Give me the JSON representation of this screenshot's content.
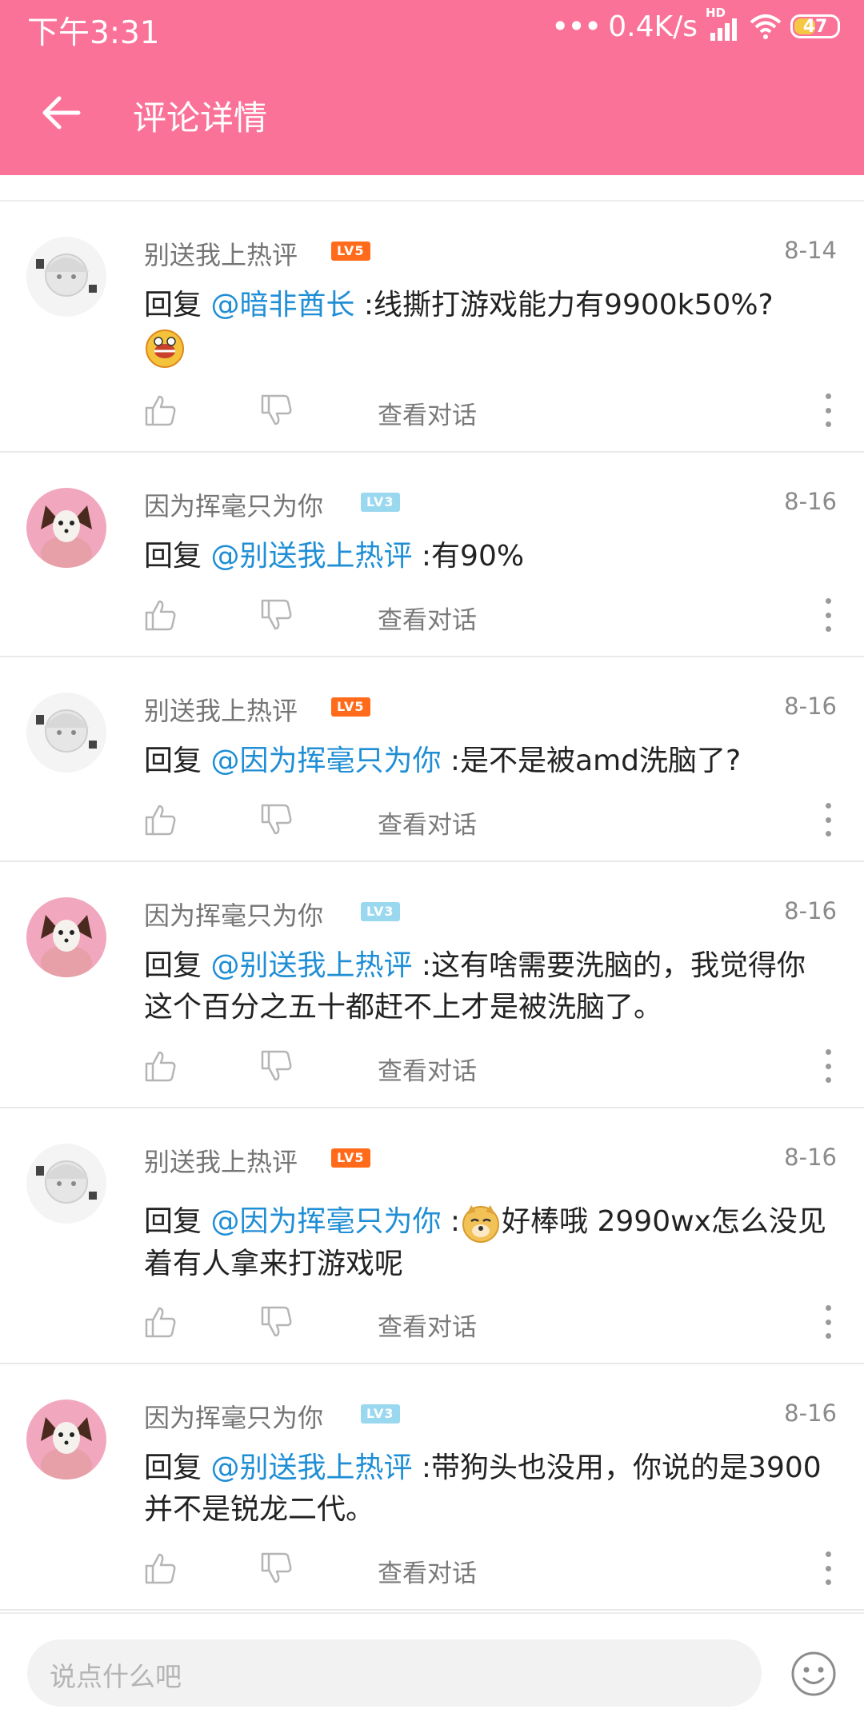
{
  "status_bar": {
    "time": "下午3:31",
    "net_speed": "0.4K/s",
    "signal": "HD",
    "battery": "47"
  },
  "nav": {
    "title": "评论详情",
    "back_icon": "arrow-left-icon"
  },
  "colors": {
    "brand": "#fb7299",
    "mention": "#1f8ed5",
    "lv5": "#ff6b1a",
    "lv3": "#9ad8f0"
  },
  "comments": [
    {
      "user": "别送我上热评",
      "level": "LV5",
      "date": "8-14",
      "reply_prefix": "回复 ",
      "mention": "@暗非酋长",
      "text": " :线撕打游戏能力有9900k50%?",
      "emoji": "surprised-emoji",
      "view_label": "查看对话"
    },
    {
      "user": "因为挥毫只为你",
      "level": "LV3",
      "date": "8-16",
      "reply_prefix": "回复 ",
      "mention": "@别送我上热评",
      "text": " :有90%",
      "view_label": "查看对话"
    },
    {
      "user": "别送我上热评",
      "level": "LV5",
      "date": "8-16",
      "reply_prefix": "回复 ",
      "mention": "@因为挥毫只为你",
      "text": " :是不是被amd洗脑了?",
      "view_label": "查看对话"
    },
    {
      "user": "因为挥毫只为你",
      "level": "LV3",
      "date": "8-16",
      "reply_prefix": "回复 ",
      "mention": "@别送我上热评",
      "text": " :这有啥需要洗脑的，我觉得你这个百分之五十都赶不上才是被洗脑了。",
      "view_label": "查看对话"
    },
    {
      "user": "别送我上热评",
      "level": "LV5",
      "date": "8-16",
      "reply_prefix": "回复 ",
      "mention": "@因为挥毫只为你",
      "text_before": " :",
      "emoji": "dog-head-emoji",
      "text": "好棒哦 2990wx怎么没见着有人拿来打游戏呢",
      "view_label": "查看对话"
    },
    {
      "user": "因为挥毫只为你",
      "level": "LV3",
      "date": "8-16",
      "reply_prefix": "回复 ",
      "mention": "@别送我上热评",
      "text": " :带狗头也没用，你说的是3900并不是锐龙二代。",
      "view_label": "查看对话"
    }
  ],
  "input": {
    "placeholder": "说点什么吧",
    "emoji_icon": "smiley-icon"
  }
}
